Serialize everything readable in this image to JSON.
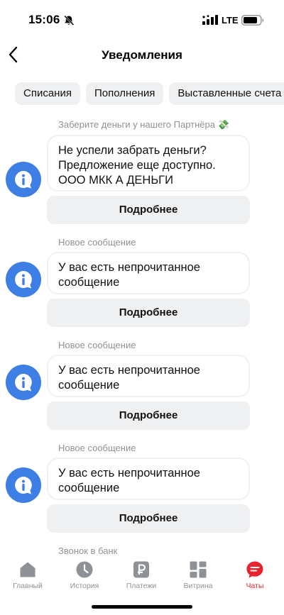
{
  "status_bar": {
    "time": "15:06",
    "network": "LTE",
    "icons": [
      "bell-off-icon",
      "signal-icon",
      "battery-icon"
    ]
  },
  "header": {
    "title": "Уведомления",
    "back_icon": "chevron-left-icon"
  },
  "filters": [
    {
      "label": "Списания"
    },
    {
      "label": "Пополнения"
    },
    {
      "label": "Выставленные счета"
    }
  ],
  "messages": [
    {
      "caption": "Заберите деньги у нашего Партнёра 💸",
      "text": "Не успели забрать деньги? Предложение еще доступно. ООО МКК А ДЕНЬГИ",
      "button": "Подробнее",
      "icon": "info-chat-icon"
    },
    {
      "caption": "Новое сообщение",
      "text": "У вас есть непрочитанное сообщение",
      "button": "Подробнее",
      "icon": "info-chat-icon"
    },
    {
      "caption": "Новое сообщение",
      "text": "У вас есть непрочитанное сообщение",
      "button": "Подробнее",
      "icon": "info-chat-icon"
    },
    {
      "caption": "Новое сообщение",
      "text": "У вас есть непрочитанное сообщение",
      "button": "Подробнее",
      "icon": "info-chat-icon"
    },
    {
      "caption": "Звонок в банк"
    }
  ],
  "tabbar": {
    "active": "Чаты",
    "items": [
      {
        "label": "Главный",
        "icon": "home-icon"
      },
      {
        "label": "История",
        "icon": "clock-icon"
      },
      {
        "label": "Платежи",
        "icon": "ruble-icon"
      },
      {
        "label": "Витрина",
        "icon": "grid-icon"
      },
      {
        "label": "Чаты",
        "icon": "chat-icon"
      }
    ]
  },
  "colors": {
    "accent_blue": "#3d7fe4",
    "active_tab_red": "#e8232e",
    "chip_background": "#eff0f2",
    "caption_gray": "#8e9297"
  }
}
